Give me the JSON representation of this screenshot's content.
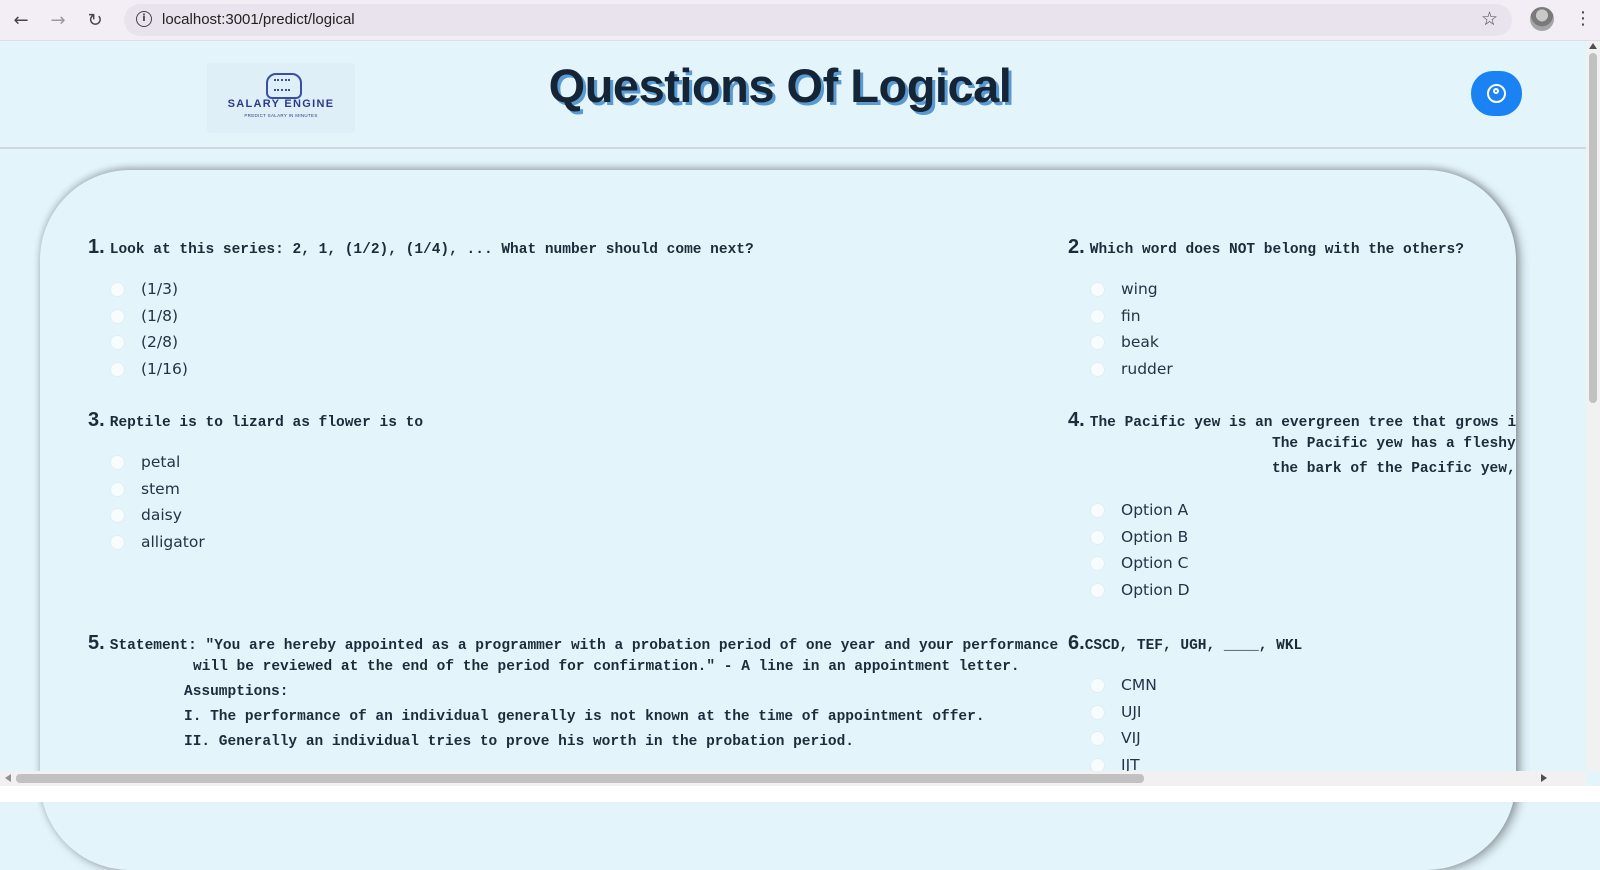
{
  "browser": {
    "url": "localhost:3001/predict/logical",
    "back_glyph": "←",
    "forward_glyph": "→",
    "reload_glyph": "↻",
    "info_glyph": "i",
    "star_glyph": "☆",
    "menu_glyph": "⋮"
  },
  "header": {
    "logo_name": "SALARY ENGINE",
    "logo_tagline": "PREDICT SALARY IN MINUTES",
    "title": "Questions Of Logical"
  },
  "questions": [
    {
      "number": "1.",
      "text": "Look at this series: 2, 1, (1/2), (1/4), ... What number should come next?",
      "options": [
        "(1/3)",
        "(1/8)",
        "(2/8)",
        "(1/16)"
      ]
    },
    {
      "number": "2.",
      "text": "Which word does NOT belong with the others?",
      "options": [
        "wing",
        "fin",
        "beak",
        "rudder"
      ]
    },
    {
      "number": "3.",
      "text": "Reptile is to lizard as flower is to",
      "options": [
        "petal",
        "stem",
        "daisy",
        "alligator"
      ]
    },
    {
      "number": "4.",
      "text": "The Pacific yew is an evergreen tree that grows in t",
      "extra_lines": [
        "The Pacific yew has a fleshy, po",
        "the bark of the Pacific yew, wa"
      ],
      "options": [
        "Option A",
        "Option B",
        "Option C",
        "Option D"
      ]
    },
    {
      "number": "5.",
      "text": "Statement: \"You are hereby appointed as a programmer with a probation period of one year and your performance",
      "extra_lines": [
        "will be reviewed at the end of the period for confirmation.\" - A line in an appointment letter.",
        "Assumptions:",
        "I. The performance of an individual generally is not known at the time of appointment offer.",
        "II. Generally an individual tries to prove his worth in the probation period."
      ]
    },
    {
      "number": "6.",
      "text": "CSCD, TEF, UGH, ____, WKL",
      "options": [
        "CMN",
        "UJI",
        "VIJ",
        "IJT"
      ]
    }
  ],
  "colors": {
    "page_background": "#e3f4fb",
    "title_shadow": "#5a9ad3",
    "account_button": "#1a82f2",
    "text": "#1e2b3a"
  }
}
